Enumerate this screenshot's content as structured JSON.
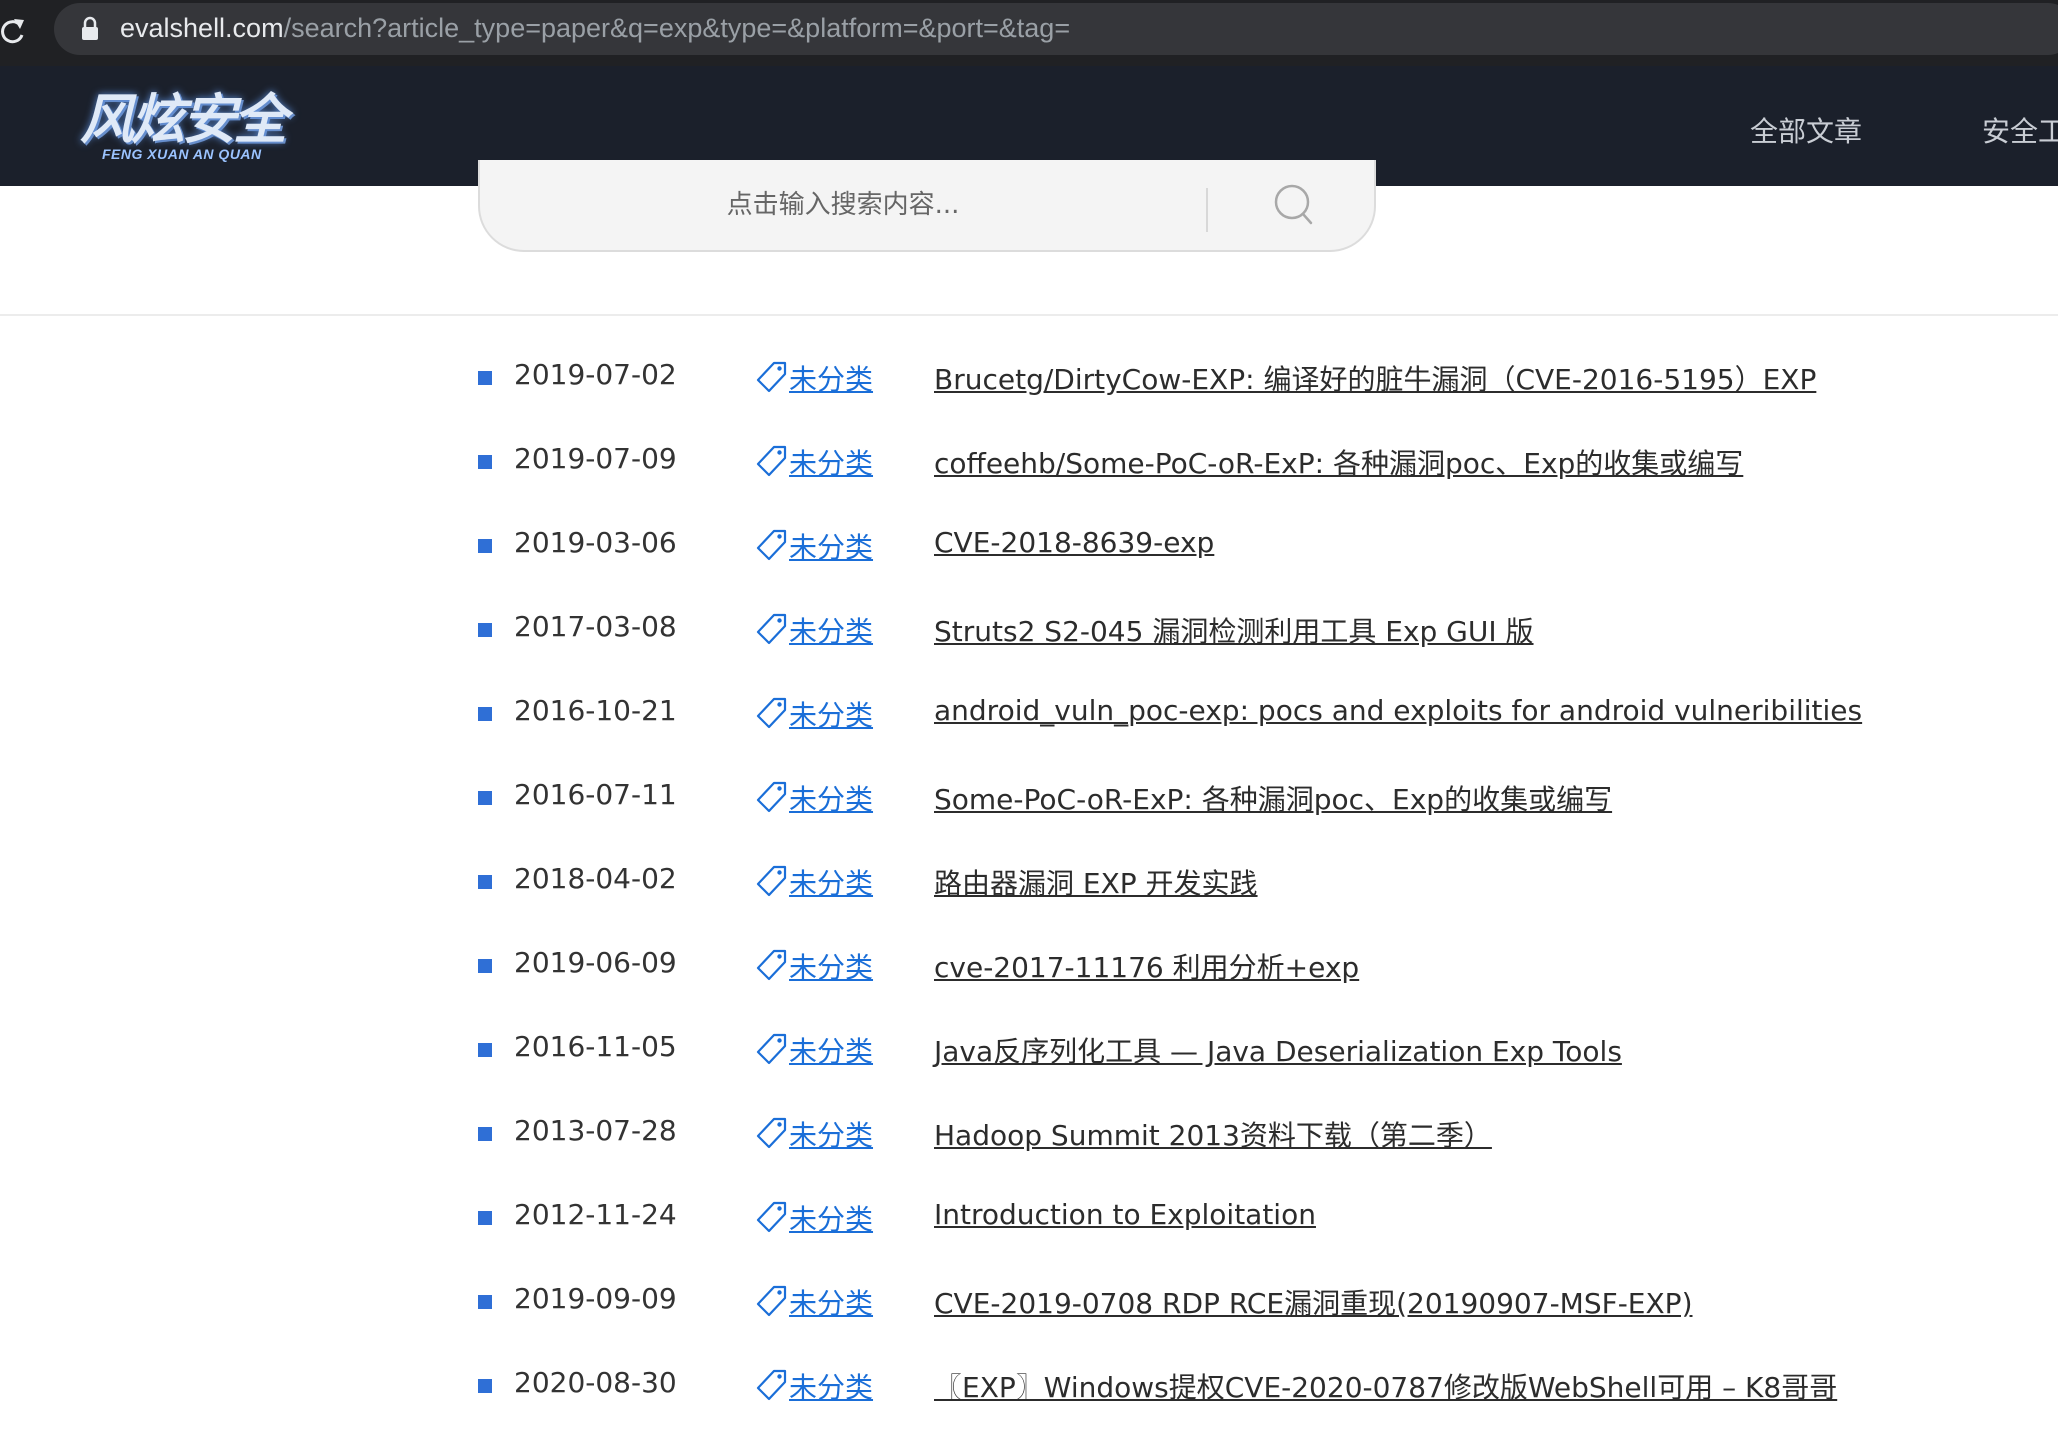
{
  "browser": {
    "url_domain": "evalshell.com",
    "url_path": "/search?article_type=paper&q=exp&type=&platform=&port=&tag="
  },
  "header": {
    "logo_cn": "风炫安全",
    "logo_en": "FENG XUAN AN QUAN",
    "nav": [
      "全部文章",
      "安全工"
    ]
  },
  "search": {
    "placeholder": "点击输入搜索内容..."
  },
  "results": [
    {
      "date": "2019-07-02",
      "category": "未分类",
      "title": "Brucetg/DirtyCow-EXP: 编译好的脏牛漏洞（CVE-2016-5195）EXP"
    },
    {
      "date": "2019-07-09",
      "category": "未分类",
      "title": "coffeehb/Some-PoC-oR-ExP: 各种漏洞poc、Exp的收集或编写"
    },
    {
      "date": "2019-03-06",
      "category": "未分类",
      "title": "CVE-2018-8639-exp"
    },
    {
      "date": "2017-03-08",
      "category": "未分类",
      "title": "Struts2 S2-045 漏洞检测利用工具 Exp GUI 版"
    },
    {
      "date": "2016-10-21",
      "category": "未分类",
      "title": "android_vuln_poc-exp: pocs and exploits for android vulneribilities"
    },
    {
      "date": "2016-07-11",
      "category": "未分类",
      "title": "Some-PoC-oR-ExP: 各种漏洞poc、Exp的收集或编写"
    },
    {
      "date": "2018-04-02",
      "category": "未分类",
      "title": "路由器漏洞 EXP 开发实践"
    },
    {
      "date": "2019-06-09",
      "category": "未分类",
      "title": "cve-2017-11176 利用分析+exp"
    },
    {
      "date": "2016-11-05",
      "category": "未分类",
      "title": "Java反序列化工具 — Java Deserialization Exp Tools"
    },
    {
      "date": "2013-07-28",
      "category": "未分类",
      "title": "Hadoop Summit 2013资料下载（第二季）"
    },
    {
      "date": "2012-11-24",
      "category": "未分类",
      "title": "Introduction to Exploitation"
    },
    {
      "date": "2019-09-09",
      "category": "未分类",
      "title": "CVE-2019-0708 RDP RCE漏洞重现(20190907-MSF-EXP)"
    },
    {
      "date": "2020-08-30",
      "category": "未分类",
      "title": "〖EXP〗Windows提权CVE-2020-0787修改版WebShell可用 – K8哥哥"
    }
  ]
}
